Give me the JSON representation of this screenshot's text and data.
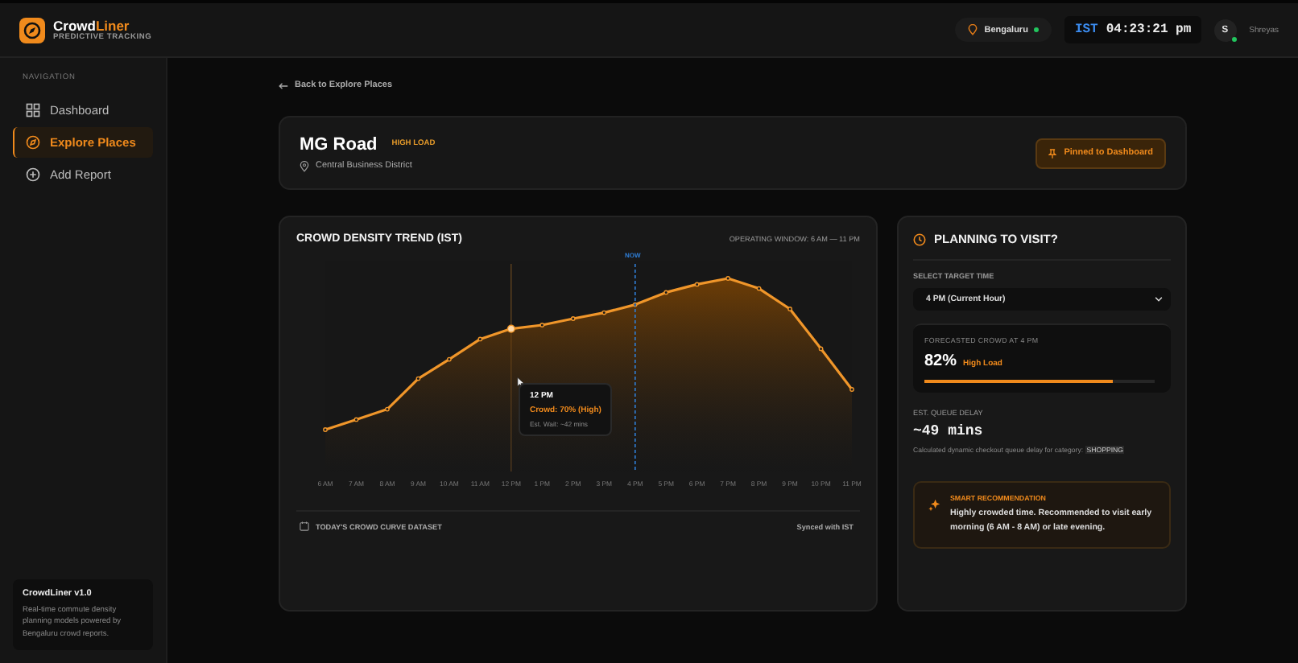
{
  "brand": {
    "name_main": "Crowd",
    "name_accent": "Liner",
    "tagline": "PREDICTIVE TRACKING"
  },
  "topbar": {
    "location": "Bengaluru",
    "location_live": true,
    "timezone": "IST",
    "time": "04:23:21 pm",
    "user_initial": "S",
    "user_name": "Shreyas",
    "user_online": true
  },
  "sidebar": {
    "section": "NAVIGATION",
    "items": [
      {
        "label": "Dashboard",
        "kind": "dashboard",
        "selected": false
      },
      {
        "label": "Explore Places",
        "kind": "explore",
        "selected": true
      },
      {
        "label": "Add Report",
        "kind": "add",
        "selected": false
      }
    ],
    "footer": {
      "title": "CrowdLiner v1.0",
      "text": "Real-time commute density planning models powered by Bengaluru crowd reports."
    }
  },
  "back_link": "Back to Explore Places",
  "place": {
    "name": "MG Road",
    "badge": "HIGH LOAD",
    "district": "Central Business District",
    "pin_button": "Pinned to Dashboard"
  },
  "trend": {
    "title": "CROWD DENSITY TREND (IST)",
    "operating_window": "OPERATING WINDOW: 6 AM — 11 PM",
    "now_label": "NOW",
    "x_labels": [
      "6 AM",
      "7 AM",
      "8 AM",
      "9 AM",
      "10 AM",
      "11 AM",
      "12 PM",
      "1 PM",
      "2 PM",
      "3 PM",
      "4 PM",
      "5 PM",
      "6 PM",
      "7 PM",
      "8 PM",
      "9 PM",
      "10 PM",
      "11 PM"
    ],
    "tooltip": {
      "time": "12 PM",
      "crowd": "Crowd: 70% (High)",
      "wait": "Est. Wait: ~42 mins"
    },
    "footer_label": "TODAY'S CROWD CURVE DATASET",
    "sync": "Synced with IST"
  },
  "planning": {
    "title": "PLANNING TO VISIT?",
    "select_label": "SELECT TARGET TIME",
    "select_value": "4 PM (Current Hour)",
    "forecast_label": "FORECASTED CROWD AT 4 PM",
    "forecast_value": "82%",
    "forecast_badge": "High Load",
    "level": 0.82,
    "queue_label": "EST. QUEUE DELAY",
    "queue_value": "~49 mins",
    "note": "Calculated dynamic checkout queue delay for category:",
    "note_category": "SHOPPING",
    "recommendation_title": "SMART RECOMMENDATION",
    "recommendation": "Highly crowded time. Recommended to visit early morning (6 AM - 8 AM) or late evening."
  }
}
